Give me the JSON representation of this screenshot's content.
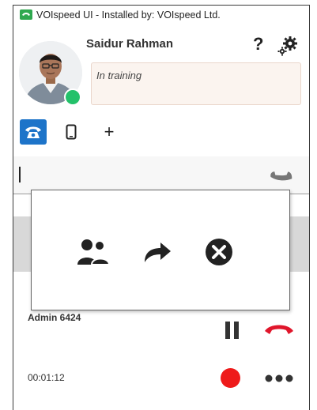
{
  "window": {
    "title": "VOIspeed UI - Installed by: VOIspeed Ltd."
  },
  "user": {
    "name": "Saidur Rahman",
    "status_message": "In training",
    "presence": "available"
  },
  "header": {
    "help_label": "?"
  },
  "tabs": [
    {
      "name": "desk-phone",
      "icon": "phone-icon",
      "active": true
    },
    {
      "name": "mobile",
      "icon": "mobile-icon",
      "active": false
    },
    {
      "name": "add",
      "label": "+",
      "active": false
    }
  ],
  "dialer": {
    "value": ""
  },
  "call": {
    "party_label": "Admin 6424",
    "timer": "00:01:12"
  },
  "popup": {
    "actions": [
      "conference-icon",
      "transfer-icon",
      "cancel-icon"
    ]
  },
  "colors": {
    "accent": "#1d74c9",
    "presence": "#23c16a",
    "record": "#ee1a1a",
    "hangup": "#e0162b",
    "status_box": "#fbf4ef"
  }
}
